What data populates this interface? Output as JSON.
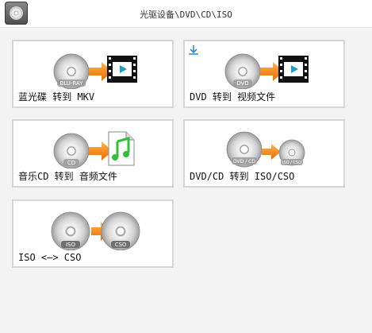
{
  "window": {
    "title": "光驱设备\\DVD\\CD\\ISO"
  },
  "icons": {
    "app": "disc-app-icon",
    "download": "download-icon",
    "arrow": "orange-arrow-icon",
    "film": "film-strip-icon",
    "music": "music-note-icon"
  },
  "colors": {
    "accent_arrow": "#f28a1a",
    "download_blue": "#2a8ad8",
    "card_border": "#d6d6d6"
  },
  "cards": [
    {
      "label": "蓝光碟 转到 MKV",
      "disc_text": "BLU-RAY"
    },
    {
      "label": "DVD 转到 视频文件",
      "disc_text": "DVD"
    },
    {
      "label": "音乐CD 转到 音频文件",
      "disc_text": "CD"
    },
    {
      "label": "DVD/CD 转到 ISO/CSO",
      "disc_text": "DVD / CD",
      "disc_text_2": "ISO / CSO"
    },
    {
      "label": "ISO <—> CSO",
      "disc_text": "ISO",
      "disc_text_2": "CSO"
    }
  ]
}
